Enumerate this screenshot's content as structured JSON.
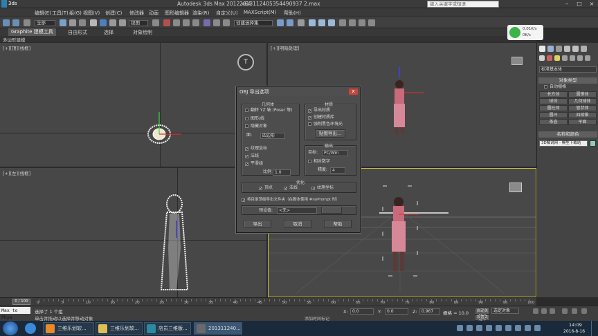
{
  "window": {
    "logo": "3ds",
    "title": "Autodesk 3ds Max  2012 x64",
    "file": "2013112405354490937 2.max",
    "search_placeholder": "键入关键字或短语"
  },
  "menu": [
    "编辑(E)",
    "工具(T)",
    "组(G)",
    "视图(V)",
    "创建(C)",
    "修改器",
    "动画",
    "图形编辑器",
    "渲染(R)",
    "自定义(U)",
    "MAXScript(M)",
    "帮助(H)"
  ],
  "toolbar": {
    "select_filter": "全部",
    "coord": "视图",
    "sel_set": "创建选择集"
  },
  "ribbon": {
    "tabs": [
      "Graphite 建模工具",
      "自由形式",
      "选择",
      "对象绘制"
    ],
    "sub": "多边形建模"
  },
  "viewports": {
    "top": "[+][顶][线框]",
    "perspective": "[+][明暗处理]",
    "left": "[+][左][线框]",
    "persp2": ""
  },
  "wifi": {
    "speed": "0.01K/s",
    "speed2": "0K/s"
  },
  "command_panel": {
    "dropdown": "标准基本体",
    "rollout1": "对象类型",
    "autogrid": "自动栅格",
    "buttons": [
      "长方体",
      "圆锥体",
      "球体",
      "几何球体",
      "圆柱体",
      "管状体",
      "圆环",
      "四棱锥",
      "茶壶",
      "平面"
    ],
    "rollout2": "名称和颜色",
    "name_value": "3D解说网 - 模型下载站"
  },
  "dialog": {
    "title": "OBJ 导出选项",
    "close": "x",
    "geometry": {
      "label": "几何体",
      "flip_yz": "翻转 YZ 轴 (Poser 等)",
      "shapes": "图形/线",
      "hidden": "隐藏对象",
      "faces_label": "面:",
      "faces_value": "四边形",
      "texcoords": "纹理坐标",
      "normals": "法线",
      "smooth": "平滑组",
      "scale_label": "比例",
      "scale_value": "1.0"
    },
    "material": {
      "label": "材质",
      "export_mat": "导出材质",
      "create_lib": "创建材质库",
      "force_black": "强制黑色环境光",
      "map_btn": "贴图导出..."
    },
    "output": {
      "label": "输出",
      "target_label": "目标:",
      "target_value": "PC/Win",
      "relative_numbers": "相对数字",
      "precision_label": "精度:",
      "precision_value": "4"
    },
    "optimize": {
      "label": "优化",
      "vertex": "顶点",
      "normals": "法线",
      "texcoords": "纹理坐标"
    },
    "use_prompt": "将目录顶级导出文件夹（在脚本使用 #noPrompt 时）",
    "preset_label": "预设值:",
    "preset_value": "<无>",
    "preset_btn": "",
    "buttons": {
      "export": "导出",
      "cancel": "取消",
      "help": "帮助"
    }
  },
  "timeline": {
    "frame": "0 / 100",
    "ticks": [
      "0",
      "5",
      "10",
      "15",
      "20",
      "25",
      "30",
      "35",
      "40",
      "45",
      "50",
      "55",
      "60",
      "65",
      "70",
      "75",
      "80",
      "85",
      "90",
      "95",
      "100"
    ]
  },
  "status": {
    "listener": "Max to Phys",
    "sel_text": "选择了 1 个组",
    "prompt": "单击并拖动以选择并移动对象",
    "x_label": "X:",
    "x_val": "0.0",
    "y_label": "Y:",
    "y_val": "0.0",
    "z_label": "Z:",
    "z_val": "0.967",
    "grid": "栅格 = 10.0",
    "autokey": "自动关键点",
    "setkey": "设置关键点",
    "key_filter": "选定对象",
    "addtime": "添加时间标记"
  },
  "taskbar": {
    "tasks": [
      "三维乐划软...",
      "三维乐划软...",
      "店员三维版...",
      "201311240..."
    ],
    "time": "14:09",
    "date": "2016-8-16"
  }
}
